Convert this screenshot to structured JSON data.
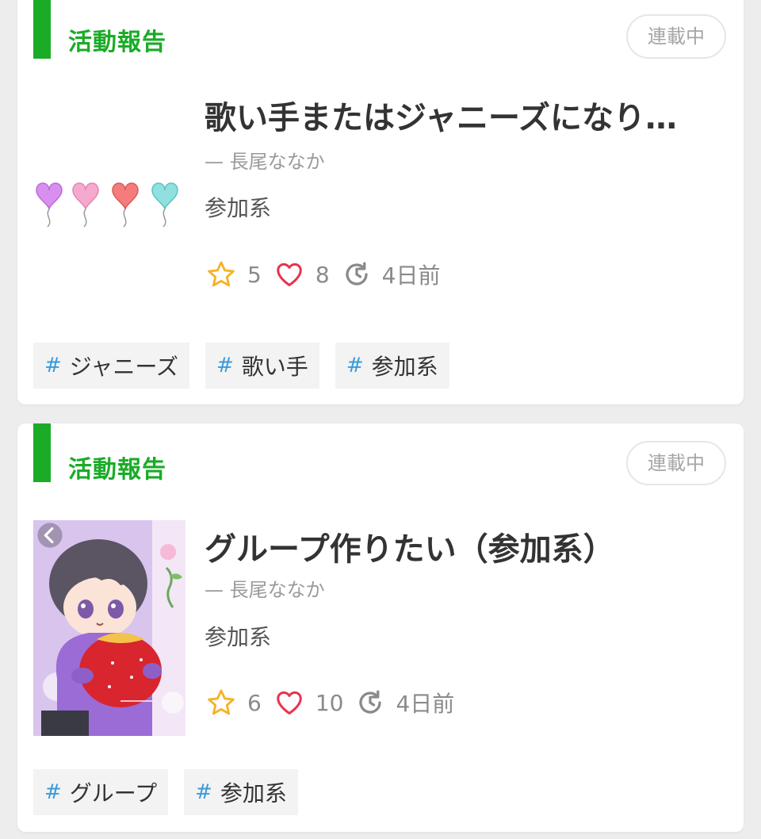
{
  "feed": {
    "cards": [
      {
        "category": "活動報告",
        "status": "連載中",
        "title": "歌い手またはジャニーズになり…",
        "author": "— 長尾ななか",
        "genre": "参加系",
        "stats": {
          "stars": "5",
          "likes": "8",
          "updated": "4日前"
        },
        "tags": [
          "ジャニーズ",
          "歌い手",
          "参加系"
        ],
        "thumbnail": "heart-balloons-image"
      },
      {
        "category": "活動報告",
        "status": "連載中",
        "title": "グループ作りたい（参加系）",
        "author": "— 長尾ななか",
        "genre": "参加系",
        "stats": {
          "stars": "6",
          "likes": "10",
          "updated": "4日前"
        },
        "tags": [
          "グループ",
          "参加系"
        ],
        "thumbnail": "chibi-boy-with-strawberry-image"
      }
    ],
    "tag_hash": "#"
  },
  "colors": {
    "category": "#1aab27",
    "star": "#f5b323",
    "heart": "#e8344e",
    "tag_hash": "#3a9ad9"
  },
  "icons": [
    "star-icon",
    "heart-icon",
    "clock-refresh-icon",
    "chevron-left-icon"
  ]
}
